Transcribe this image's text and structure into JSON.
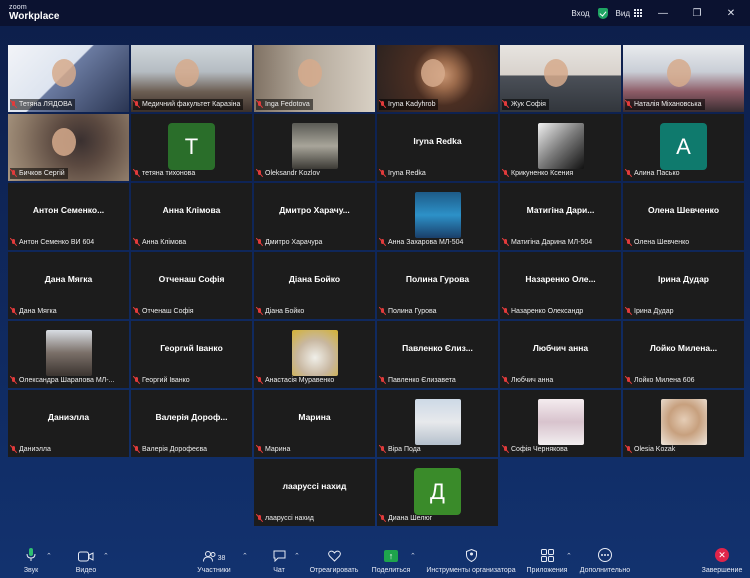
{
  "app": {
    "brand_small": "zoom",
    "brand_name": "Workplace"
  },
  "titlebar": {
    "signin": "Вход",
    "view": "Вид"
  },
  "participants": [
    {
      "label": "Тетяна ЛЯДОВА",
      "display": "",
      "kind": "video",
      "style": "v1"
    },
    {
      "label": "Медичний факультет Каразіна",
      "display": "",
      "kind": "video",
      "style": "v2",
      "active": true
    },
    {
      "label": "Inga Fedotova",
      "display": "",
      "kind": "video",
      "style": "v3"
    },
    {
      "label": "Iryna Kadyhrob",
      "display": "",
      "kind": "video",
      "style": "v4"
    },
    {
      "label": "Жук Софія",
      "display": "",
      "kind": "video",
      "style": "v5"
    },
    {
      "label": "Наталія Міхановська",
      "display": "",
      "kind": "video",
      "style": "v6"
    },
    {
      "label": "Бичков Сергій",
      "display": "",
      "kind": "video",
      "style": "v7"
    },
    {
      "label": "тетяна тихонова",
      "display": "",
      "kind": "letter",
      "letter": "T",
      "style": "t-green"
    },
    {
      "label": "Oleksandr Kozlov",
      "display": "",
      "kind": "image",
      "style": "img-man"
    },
    {
      "label": "Iryna Redka",
      "display": "Iryna Redka",
      "kind": "name"
    },
    {
      "label": "Крикуненко Ксения",
      "display": "",
      "kind": "image",
      "style": "img-mono"
    },
    {
      "label": "Алина Пасько",
      "display": "",
      "kind": "letter",
      "letter": "A",
      "style": "t-teal"
    },
    {
      "label": "Антон Семенко ВИ 604",
      "display": "Антон  Семенко...",
      "kind": "name"
    },
    {
      "label": "Анна Клімова",
      "display": "Анна Клімова",
      "kind": "name"
    },
    {
      "label": "Дмитро Харачура",
      "display": "Дмитро  Харачу...",
      "kind": "name"
    },
    {
      "label": "Анна Захарова МЛ-504",
      "display": "",
      "kind": "image",
      "style": "img-pool"
    },
    {
      "label": "Матигіна Дарина МЛ-504",
      "display": "Матигіна  Дари...",
      "kind": "name"
    },
    {
      "label": "Олена Шевченко",
      "display": "Олена Шевченко",
      "kind": "name"
    },
    {
      "label": "Дана Мягка",
      "display": "Дана Мягка",
      "kind": "name"
    },
    {
      "label": "Отченаш Софія",
      "display": "Отченаш Софія",
      "kind": "name"
    },
    {
      "label": "Діана Бойко",
      "display": "Діана Бойко",
      "kind": "name"
    },
    {
      "label": "Полина Гурова",
      "display": "Полина Гурова",
      "kind": "name"
    },
    {
      "label": "Назаренко Олександр",
      "display": "Назаренко  Оле...",
      "kind": "name"
    },
    {
      "label": "Ірина Дудар",
      "display": "Ірина Дудар",
      "kind": "name"
    },
    {
      "label": "Олександра Шарапова МЛ-...",
      "display": "",
      "kind": "image",
      "style": "img-winter"
    },
    {
      "label": "Георгий Іванко",
      "display": "Георгий Іванко",
      "kind": "name"
    },
    {
      "label": "Анастасія Муравенко",
      "display": "",
      "kind": "image",
      "style": "img-cat"
    },
    {
      "label": "Павленко Єлизавета",
      "display": "Павленко  Єлиз...",
      "kind": "name"
    },
    {
      "label": "Любчич анна",
      "display": "Любчич анна",
      "kind": "name"
    },
    {
      "label": "Лойко Милена 606",
      "display": "Лойко  Милена...",
      "kind": "name"
    },
    {
      "label": "Даниэлла",
      "display": "Даниэлла",
      "kind": "name"
    },
    {
      "label": "Валерія Дорофеєва",
      "display": "Валерія  Дороф...",
      "kind": "name"
    },
    {
      "label": "Марина",
      "display": "Марина",
      "kind": "name"
    },
    {
      "label": "Віра Пода",
      "display": "",
      "kind": "image",
      "style": "img-girl"
    },
    {
      "label": "Софія Чернякова",
      "display": "",
      "kind": "image",
      "style": "img-draw"
    },
    {
      "label": "Olesia Kozak",
      "display": "",
      "kind": "image",
      "style": "img-doll"
    },
    {
      "label": "лааруссі нахид",
      "display": "лааруссі нахид",
      "kind": "name",
      "col": 3
    },
    {
      "label": "Диана Шелюг",
      "display": "",
      "kind": "letter",
      "letter": "Д",
      "style": "t-green2",
      "col": 4
    }
  ],
  "toolbar": {
    "audio": "Звук",
    "video": "Видео",
    "participants": "Участники",
    "participants_count": "38",
    "chat": "Чат",
    "react": "Отреагировать",
    "share": "Поделиться",
    "host_tools": "Инструменты организатора",
    "apps": "Приложения",
    "more": "Дополнительно",
    "end": "Завершение"
  },
  "colors": {
    "active_speaker": "#26c6a8",
    "share": "#1ea44c",
    "end": "#e0244a",
    "muted": "#e23b3b"
  }
}
